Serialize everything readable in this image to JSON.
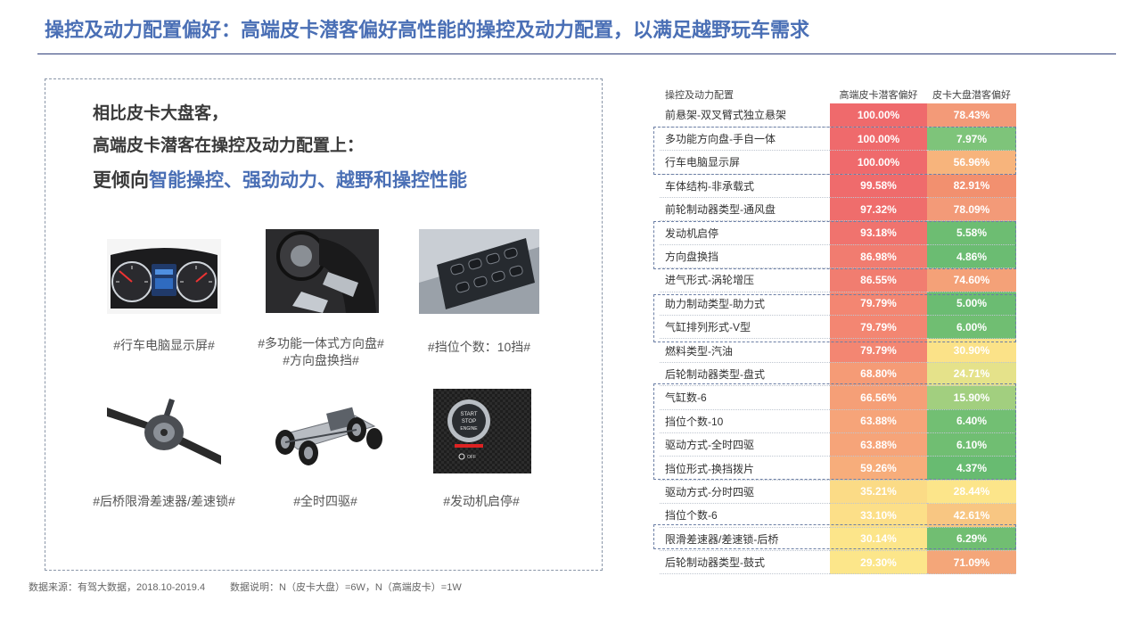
{
  "title": "操控及动力配置偏好：高端皮卡潜客偏好高性能的操控及动力配置，以满足越野玩车需求",
  "questions": {
    "line1": "相比皮卡大盘客，",
    "line2": "高端皮卡潜客在操控及动力配置上：",
    "line3_prefix": "更倾向",
    "line3_highlight": "智能操控、强劲动力、越野和操控性能"
  },
  "images": [
    {
      "name": "dashboard",
      "caption": "#行车电脑显示屏#"
    },
    {
      "name": "steering",
      "caption1": "#多功能一体式方向盘#",
      "caption2": "#方向盘换挡#"
    },
    {
      "name": "buttons",
      "caption": "#挡位个数：10挡#"
    },
    {
      "name": "axle",
      "caption": "#后桥限滑差速器/差速锁#"
    },
    {
      "name": "chassis",
      "caption": "#全时四驱#"
    },
    {
      "name": "start",
      "caption": "#发动机启停#",
      "btn_line1": "START",
      "btn_line2": "STOP",
      "btn_line3": "ENGINE",
      "btn_off": "OFF"
    }
  ],
  "source": {
    "left": "数据来源：有驾大数据，2018.10-2019.4",
    "right": "数据说明：N（皮卡大盘）=6W，N（高端皮卡）=1W"
  },
  "table": {
    "headers": [
      "操控及动力配置",
      "高端皮卡潜客偏好",
      "皮卡大盘潜客偏好"
    ],
    "rows": [
      {
        "name": "前悬架-双叉臂式独立悬架",
        "a": "100.00%",
        "b": "78.43%",
        "ca": "#ef6a6c",
        "cb": "#f39a78"
      },
      {
        "name": "多功能方向盘-手自一体",
        "a": "100.00%",
        "b": "7.97%",
        "ca": "#ef6a6c",
        "cb": "#7ec47a"
      },
      {
        "name": "行车电脑显示屏",
        "a": "100.00%",
        "b": "56.96%",
        "ca": "#ef6a6c",
        "cb": "#f7b47c"
      },
      {
        "name": "车体结构-非承载式",
        "a": "99.58%",
        "b": "82.91%",
        "ca": "#ef6b6c",
        "cb": "#f2906f"
      },
      {
        "name": "前轮制动器类型-通风盘",
        "a": "97.32%",
        "b": "78.09%",
        "ca": "#ef6d6c",
        "cb": "#f39a78"
      },
      {
        "name": "发动机启停",
        "a": "93.18%",
        "b": "5.58%",
        "ca": "#f0736e",
        "cb": "#6dbd72"
      },
      {
        "name": "方向盘换挡",
        "a": "86.98%",
        "b": "4.86%",
        "ca": "#f17c70",
        "cb": "#6bbc72"
      },
      {
        "name": "进气形式-涡轮增压",
        "a": "86.55%",
        "b": "74.60%",
        "ca": "#f17d70",
        "cb": "#f4a178"
      },
      {
        "name": "助力制动类型-助力式",
        "a": "79.79%",
        "b": "5.00%",
        "ca": "#f38672",
        "cb": "#6bbc72"
      },
      {
        "name": "气缸排列形式-V型",
        "a": "79.79%",
        "b": "6.00%",
        "ca": "#f38672",
        "cb": "#70be72"
      },
      {
        "name": "燃料类型-汽油",
        "a": "79.79%",
        "b": "30.90%",
        "ca": "#f38672",
        "cb": "#fbe288"
      },
      {
        "name": "后轮制动器类型-盘式",
        "a": "68.80%",
        "b": "24.71%",
        "ca": "#f59b76",
        "cb": "#e5e28a"
      },
      {
        "name": "气缸数-6",
        "a": "66.56%",
        "b": "15.90%",
        "ca": "#f59f77",
        "cb": "#a2cf7f"
      },
      {
        "name": "挡位个数-10",
        "a": "63.88%",
        "b": "6.40%",
        "ca": "#f6a479",
        "cb": "#72bf73"
      },
      {
        "name": "驱动方式-全时四驱",
        "a": "63.88%",
        "b": "6.10%",
        "ca": "#f6a479",
        "cb": "#70be72"
      },
      {
        "name": "挡位形式-换挡拨片",
        "a": "59.26%",
        "b": "4.37%",
        "ca": "#f7ad7b",
        "cb": "#68bb71"
      },
      {
        "name": "驱动方式-分时四驱",
        "a": "35.21%",
        "b": "28.44%",
        "ca": "#fbdb86",
        "cb": "#fce58a"
      },
      {
        "name": "挡位个数-6",
        "a": "33.10%",
        "b": "42.61%",
        "ca": "#fcdf88",
        "cb": "#f8c682"
      },
      {
        "name": "限滑差速器/差速锁-后桥",
        "a": "30.14%",
        "b": "6.29%",
        "ca": "#fce58a",
        "cb": "#71be72"
      },
      {
        "name": "后轮制动器类型-鼓式",
        "a": "29.30%",
        "b": "71.09%",
        "ca": "#fce68a",
        "cb": "#f4a679"
      }
    ]
  },
  "colors": {
    "accent": "#4a6fb5",
    "rule": "#2f3f7a"
  }
}
